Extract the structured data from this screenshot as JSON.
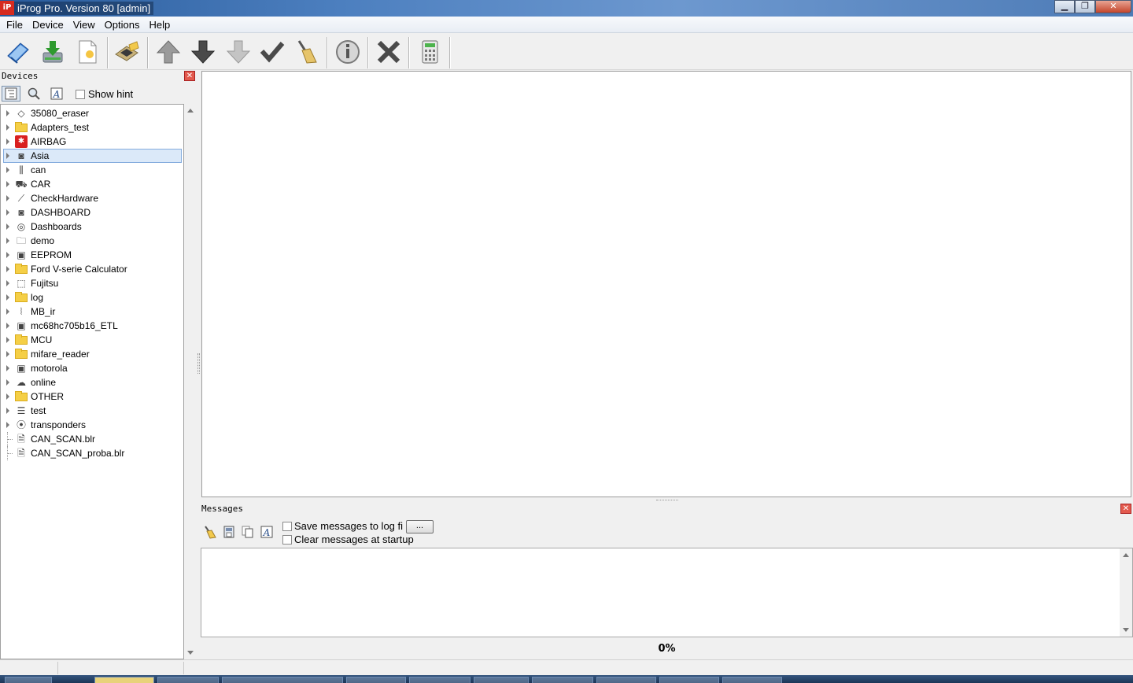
{
  "window": {
    "title": "iProg Pro. Version 80 [admin]",
    "logo_text": "iP"
  },
  "window_controls": {
    "minimize": "▁",
    "maximize": "❐",
    "close": "✕"
  },
  "menu": [
    "File",
    "Device",
    "View",
    "Options",
    "Help"
  ],
  "devices_panel": {
    "title": "Devices",
    "close_glyph": "✕",
    "show_hint_label": "Show hint",
    "items": [
      {
        "label": "35080_eraser",
        "icon": "eraser-icon",
        "glyph": "◇",
        "type": "node"
      },
      {
        "label": "Adapters_test",
        "icon": "folder-icon",
        "glyph": "",
        "type": "folder"
      },
      {
        "label": "AIRBAG",
        "icon": "airbag-icon",
        "glyph": "✱",
        "type": "red"
      },
      {
        "label": "Asia",
        "icon": "dashboard-icon",
        "glyph": "◙",
        "type": "node",
        "selected": true
      },
      {
        "label": "can",
        "icon": "can-plug-icon",
        "glyph": "⫼",
        "type": "node"
      },
      {
        "label": "CAR",
        "icon": "car-icon",
        "glyph": "⛟",
        "type": "node"
      },
      {
        "label": "CheckHardware",
        "icon": "probe-icon",
        "glyph": "⟋",
        "type": "node"
      },
      {
        "label": "DASHBOARD",
        "icon": "dashboard-icon",
        "glyph": "◙",
        "type": "node"
      },
      {
        "label": "Dashboards",
        "icon": "gauge-icon",
        "glyph": "◎",
        "type": "node"
      },
      {
        "label": "demo",
        "icon": "folder-outline-icon",
        "glyph": "🗀",
        "type": "node"
      },
      {
        "label": "EEPROM",
        "icon": "chip-icon",
        "glyph": "▣",
        "type": "node"
      },
      {
        "label": "Ford V-serie Calculator",
        "icon": "folder-icon",
        "glyph": "",
        "type": "folder"
      },
      {
        "label": "Fujitsu",
        "icon": "chip-outline-icon",
        "glyph": "⬚",
        "type": "node"
      },
      {
        "label": "log",
        "icon": "folder-icon",
        "glyph": "",
        "type": "folder"
      },
      {
        "label": "MB_ir",
        "icon": "infrared-icon",
        "glyph": "⦚",
        "type": "node"
      },
      {
        "label": "mc68hc705b16_ETL",
        "icon": "chip-icon",
        "glyph": "▣",
        "type": "node"
      },
      {
        "label": "MCU",
        "icon": "folder-icon",
        "glyph": "",
        "type": "folder"
      },
      {
        "label": "mifare_reader",
        "icon": "folder-icon",
        "glyph": "",
        "type": "folder"
      },
      {
        "label": "motorola",
        "icon": "chip-icon",
        "glyph": "▣",
        "type": "node"
      },
      {
        "label": "online",
        "icon": "cloud-icon",
        "glyph": "☁",
        "type": "node"
      },
      {
        "label": "OTHER",
        "icon": "folder-icon",
        "glyph": "",
        "type": "folder"
      },
      {
        "label": "test",
        "icon": "list-icon",
        "glyph": "☰",
        "type": "node"
      },
      {
        "label": "transponders",
        "icon": "antenna-icon",
        "glyph": "⦿",
        "type": "node"
      },
      {
        "label": "CAN_SCAN.blr",
        "icon": "file-icon",
        "glyph": "🗎",
        "type": "leaf"
      },
      {
        "label": "CAN_SCAN_proba.blr",
        "icon": "file-icon",
        "glyph": "🗎",
        "type": "leaf"
      }
    ]
  },
  "messages_panel": {
    "title": "Messages",
    "close_glyph": "✕",
    "save_label": "Save messages to log fi",
    "browse_label": "...",
    "clear_label": "Clear messages at startup",
    "progress": "0%"
  },
  "colors": {
    "accent": "#2a5c9c",
    "selection": "#dbe9f9",
    "folder": "#f5cf46",
    "close": "#e35a4e"
  }
}
